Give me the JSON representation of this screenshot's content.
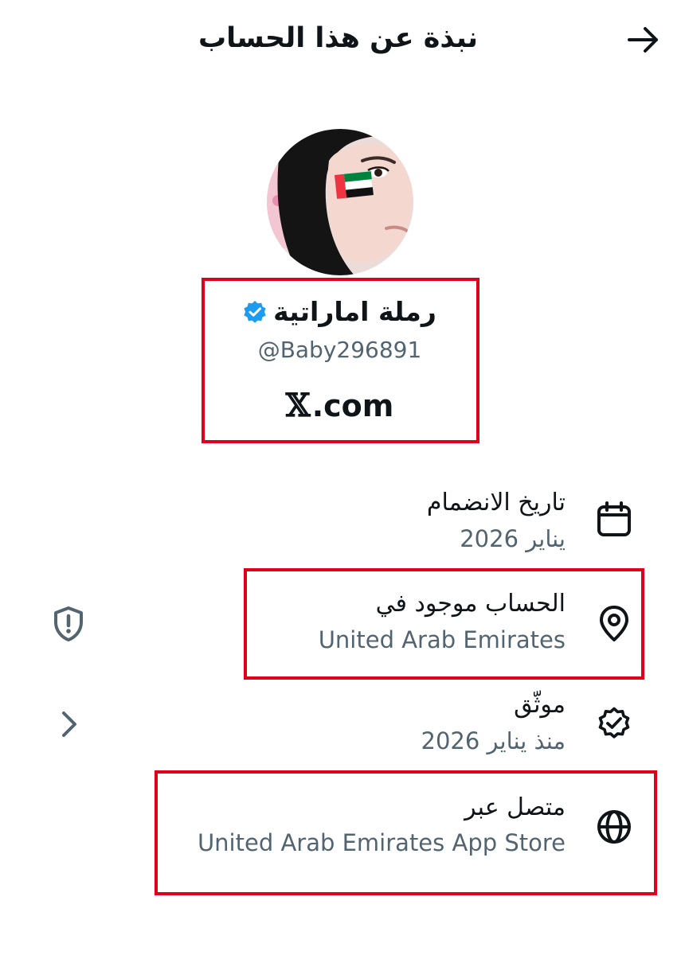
{
  "header": {
    "title": "نبذة عن هذا الحساب",
    "back_icon": "arrow-right-icon"
  },
  "profile": {
    "avatar_icon": "profile-avatar",
    "display_name": "رملة اماراتية",
    "verified_icon": "verified-badge-icon",
    "handle": "@Baby296891",
    "site_logo": "𝕏",
    "site_domain": ".com"
  },
  "rows": [
    {
      "icon": "calendar-icon",
      "label": "تاريخ الانضمام",
      "value": "يناير 2026"
    },
    {
      "icon": "location-pin-icon",
      "label": "الحساب موجود في",
      "value": "United Arab Emirates",
      "side_icon": "shield-alert-icon"
    },
    {
      "icon": "verified-check-icon",
      "label": "موثّق",
      "value": "منذ يناير 2026",
      "side_icon": "chevron-right-icon"
    },
    {
      "icon": "globe-icon",
      "label": "متصل عبر",
      "value": "United Arab Emirates App Store"
    }
  ],
  "colors": {
    "text_primary": "#0f1419",
    "text_secondary": "#536471",
    "verified_blue": "#1d9bf0",
    "highlight_red": "#e0001b",
    "uae_green": "#00843d",
    "uae_red": "#ef3340"
  }
}
